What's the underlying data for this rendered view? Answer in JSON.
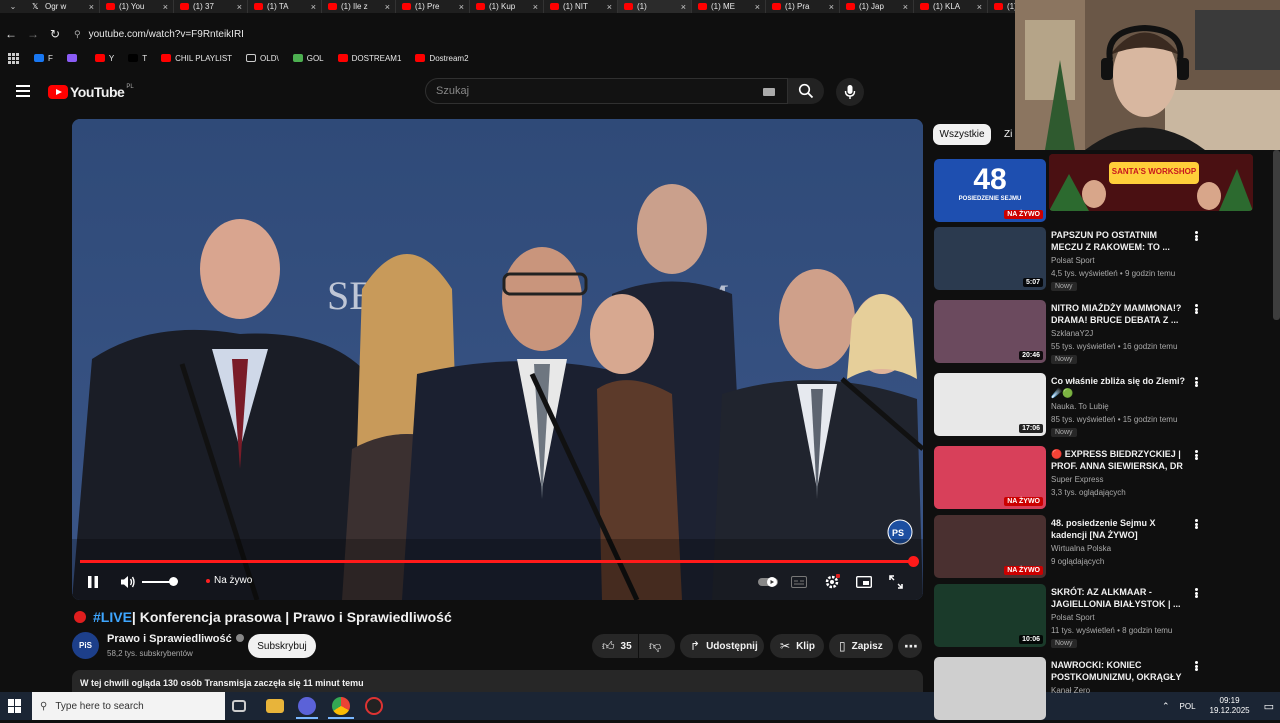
{
  "browser": {
    "tabs": [
      {
        "label": "Ogr w",
        "icon": "x-icon"
      },
      {
        "label": "(1) You",
        "icon": "youtube-icon"
      },
      {
        "label": "(1) 37",
        "icon": "youtube-icon"
      },
      {
        "label": "(1) TA",
        "icon": "youtube-icon"
      },
      {
        "label": "(1) Ile z",
        "icon": "youtube-icon"
      },
      {
        "label": "(1) Pre",
        "icon": "youtube-icon"
      },
      {
        "label": "(1) Kup",
        "icon": "youtube-icon"
      },
      {
        "label": "(1) NIT",
        "icon": "youtube-icon"
      },
      {
        "label": "(1)",
        "icon": "youtube-icon"
      },
      {
        "label": "(1) ME",
        "icon": "youtube-icon"
      },
      {
        "label": "(1) Pra",
        "icon": "youtube-icon"
      },
      {
        "label": "(1) Jap",
        "icon": "youtube-icon"
      },
      {
        "label": "(1) KLA",
        "icon": "youtube-icon"
      },
      {
        "label": "(1)",
        "icon": "youtube-icon"
      }
    ],
    "url": "youtube.com/watch?v=F9RnteikIRI",
    "bookmarks": [
      {
        "label": "F",
        "color": "#1877f2"
      },
      {
        "label": "",
        "color": "#8b5cf6"
      },
      {
        "label": "Y",
        "color": "#ff0000"
      },
      {
        "label": "T",
        "color": "#000000"
      },
      {
        "label": "CHIL PLAYLIST",
        "color": "#ff0000"
      },
      {
        "label": "OLD\\",
        "color": "folder"
      },
      {
        "label": "GOL",
        "color": "#4caf50"
      },
      {
        "label": "DOSTREAM1",
        "color": "#ff0000"
      },
      {
        "label": "Dostream2",
        "color": "#ff0000"
      }
    ]
  },
  "youtube": {
    "logo_text": "YouTube",
    "logo_region": "PL",
    "search_placeholder": "Szukaj"
  },
  "player": {
    "live_label": "Na żywo",
    "progress_fraction": 0.998,
    "volume_fraction": 1.0
  },
  "video": {
    "tag": "#LIVE",
    "title": " | Konferencja prasowa | Prawo i Sprawiedliwość",
    "channel_name": "Prawo i Sprawiedliwość",
    "channel_avatar_text": "PiS",
    "subscribers": "58,2 tys. subskrybentów",
    "subscribe_label": "Subskrybuj",
    "likes": "35",
    "share_label": "Udostępnij",
    "clip_label": "Klip",
    "save_label": "Zapisz",
    "description_line": "W tej chwili ogląda 130 osób  Transmisja zaczęła się 11 minut temu"
  },
  "sidebar": {
    "chip_all": "Wszystkie",
    "chip_next": "Zi",
    "first_thumb_number": "48",
    "first_thumb_caption": "POSIEDZENIE SEJMU",
    "first_thumb_badge": "NA ŻYWO",
    "banner_text": "SANTA'S WORKSHOP",
    "items": [
      {
        "title": "PAPSZUN PO OSTATNIM MECZU Z RAKOWEM: TO ...",
        "channel": "Polsat Sport",
        "meta": "4,5 tys. wyświetleń • 9 godzin temu",
        "tag": "Nowy",
        "badge": "5:07",
        "live": false,
        "thumb_color": "#2b3a4f"
      },
      {
        "title": "NITRO MIAŻDŻY MAMMONA!? DRAMA! BRUCE DEBATA Z ...",
        "channel": "SzklanaY2J",
        "meta": "55 tys. wyświetleń • 16 godzin temu",
        "tag": "Nowy",
        "badge": "20:46",
        "live": false,
        "thumb_color": "#6b4a5e"
      },
      {
        "title": "Co właśnie zbliża się do Ziemi? ☄️🟢",
        "channel": "Nauka. To Lubię",
        "meta": "85 tys. wyświetleń • 15 godzin temu",
        "tag": "Nowy",
        "badge": "17:06",
        "live": false,
        "thumb_color": "#e8e8e8"
      },
      {
        "title": "🔴 EXPRESS BIEDRZYCKIEJ | PROF. ANNA SIEWIERSKA, DR ...",
        "channel": "Super Express",
        "meta": "3,3 tys. oglądających",
        "tag": "",
        "badge": "NA ŻYWO",
        "live": true,
        "thumb_color": "#d8405a"
      },
      {
        "title": "48. posiedzenie Sejmu X kadencji [NA ŻYWO]",
        "channel": "Wirtualna Polska",
        "meta": "9 oglądających",
        "tag": "",
        "badge": "NA ŻYWO",
        "live": true,
        "thumb_color": "#4a3030"
      },
      {
        "title": "SKRÓT: AZ ALKMAAR - JAGIELLONIA BIAŁYSTOK | ...",
        "channel": "Polsat Sport",
        "meta": "11 tys. wyświetleń • 8 godzin temu",
        "tag": "Nowy",
        "badge": "10:06",
        "live": false,
        "thumb_color": "#1a3a2a"
      },
      {
        "title": "NAWROCKI: KONIEC POSTKOMUNIZMU, OKRĄGŁY ...",
        "channel": "Kanał Zero",
        "meta": "",
        "tag": "",
        "badge": "",
        "live": false,
        "thumb_color": "#cfcfcf"
      }
    ]
  },
  "taskbar": {
    "search_placeholder": "Type here to search",
    "language": "POL",
    "time": "09:19",
    "date": "19.12.2025"
  },
  "colors": {
    "accent_red": "#ff0000",
    "link_blue": "#3ea6ff",
    "background": "#0f0f0f"
  }
}
